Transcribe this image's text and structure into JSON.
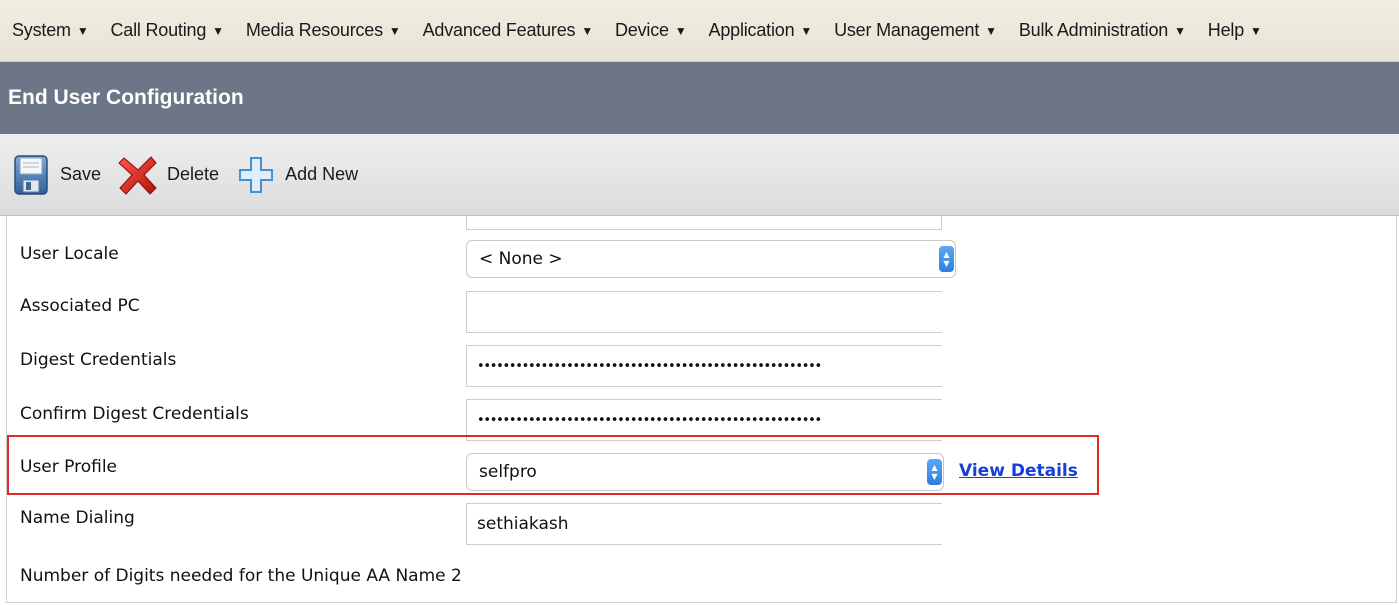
{
  "menu": {
    "items": [
      {
        "label": "System"
      },
      {
        "label": "Call Routing"
      },
      {
        "label": "Media Resources"
      },
      {
        "label": "Advanced Features"
      },
      {
        "label": "Device"
      },
      {
        "label": "Application"
      },
      {
        "label": "User Management"
      },
      {
        "label": "Bulk Administration"
      },
      {
        "label": "Help"
      }
    ],
    "caret": "▼"
  },
  "page": {
    "title": "End User Configuration"
  },
  "toolbar": {
    "save_label": "Save",
    "delete_label": "Delete",
    "add_new_label": "Add New",
    "save_icon": "floppy-disk-icon",
    "delete_icon": "red-x-icon",
    "add_icon": "blue-plus-icon"
  },
  "form": {
    "user_locale": {
      "label": "User Locale",
      "value": "< None >"
    },
    "associated_pc": {
      "label": "Associated PC",
      "value": ""
    },
    "digest_credentials": {
      "label": "Digest Credentials",
      "value": "••••••••••••••••••••••••••••••••••••••••••••••••••••••"
    },
    "confirm_digest_credentials": {
      "label": "Confirm Digest Credentials",
      "value": "••••••••••••••••••••••••••••••••••••••••••••••••••••••"
    },
    "user_profile": {
      "label": "User Profile",
      "value": "selfpro",
      "link": "View Details"
    },
    "name_dialing": {
      "label": "Name Dialing",
      "value": "sethiakash"
    },
    "unique_aa_digits": {
      "label": "Number of Digits needed for the Unique AA Name 2"
    }
  },
  "colors": {
    "highlight": "#e02a2a",
    "title_bar": "#6c7686",
    "link": "#1a3fd8"
  }
}
